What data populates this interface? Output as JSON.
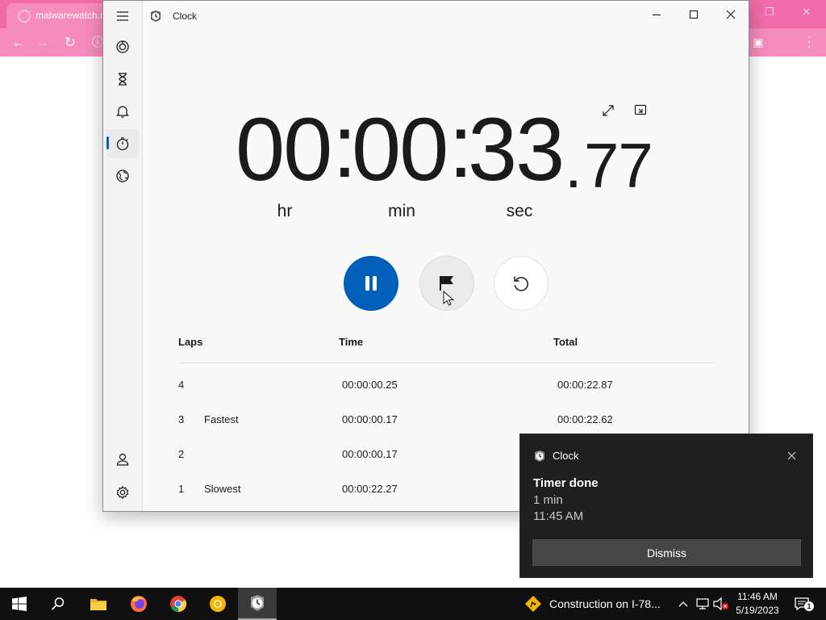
{
  "browser": {
    "tab_title": "malwarewatch.c",
    "favicon": "tab-favicon-icon"
  },
  "clock_app": {
    "title": "Clock",
    "nav": [
      {
        "name": "focus-sessions-icon"
      },
      {
        "name": "timer-icon"
      },
      {
        "name": "alarm-icon"
      },
      {
        "name": "stopwatch-icon",
        "active": true
      },
      {
        "name": "world-clock-icon"
      }
    ],
    "nav_bottom": [
      {
        "name": "account-icon"
      },
      {
        "name": "settings-icon"
      }
    ],
    "stopwatch": {
      "hours": "00",
      "minutes": "00",
      "seconds": "33",
      "fraction": "77",
      "separator": ":",
      "decimal": ".",
      "unit_hr": "hr",
      "unit_min": "min",
      "unit_sec": "sec"
    },
    "laps_header": {
      "laps": "Laps",
      "time": "Time",
      "total": "Total"
    },
    "laps": [
      {
        "number": "4",
        "tag": "",
        "time": "00:00:00.25",
        "total": "00:00:22.87"
      },
      {
        "number": "3",
        "tag": "Fastest",
        "time": "00:00:00.17",
        "total": "00:00:22.62"
      },
      {
        "number": "2",
        "tag": "",
        "time": "00:00:00.17",
        "total": ""
      },
      {
        "number": "1",
        "tag": "Slowest",
        "time": "00:00:22.27",
        "total": ""
      }
    ],
    "accent": "#005fb8"
  },
  "toast": {
    "app_name": "Clock",
    "title": "Timer done",
    "line1": "1 min",
    "line2": "11:45 AM",
    "dismiss_label": "Dismiss"
  },
  "taskbar": {
    "news_text": "Construction on I-78...",
    "time": "11:46 AM",
    "date": "5/19/2023",
    "notification_count": "1"
  }
}
